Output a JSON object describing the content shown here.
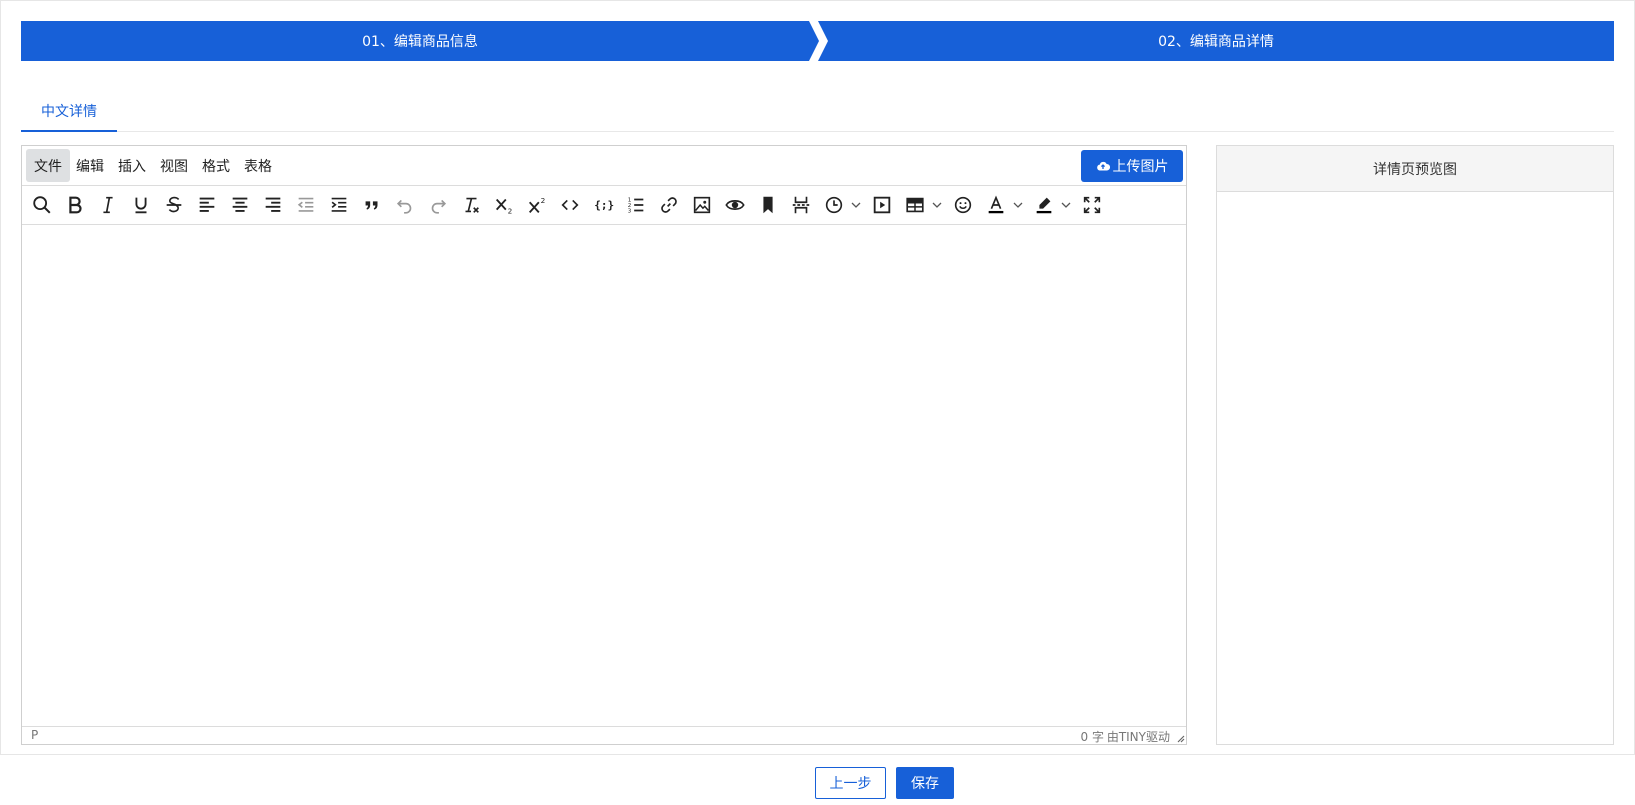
{
  "steps": [
    {
      "label": "01、编辑商品信息"
    },
    {
      "label": "02、编辑商品详情"
    }
  ],
  "tabs": [
    {
      "label": "中文详情"
    }
  ],
  "editor": {
    "menu": [
      "文件",
      "编辑",
      "插入",
      "视图",
      "格式",
      "表格"
    ],
    "active_menu": "文件",
    "upload_label": "上传图片",
    "toolbar_icons": [
      "search-icon",
      "bold-icon",
      "italic-icon",
      "underline-icon",
      "strikethrough-icon",
      "align-left-icon",
      "align-center-icon",
      "align-right-icon",
      "outdent-icon",
      "indent-icon",
      "blockquote-icon",
      "undo-icon",
      "redo-icon",
      "remove-format-icon",
      "subscript-icon",
      "superscript-icon",
      "code-icon",
      "codesample-icon",
      "numbered-list-icon",
      "link-icon",
      "image-icon",
      "preview-icon",
      "bookmark-icon",
      "page-break-icon",
      "time-icon",
      "media-icon",
      "table-icon",
      "emoji-icon",
      "text-color-icon",
      "highlight-icon",
      "fullscreen-icon"
    ],
    "status_path": "P",
    "word_count": "0 字",
    "powered_by": "由TINY驱动"
  },
  "preview": {
    "title": "详情页预览图"
  },
  "footer": {
    "prev_label": "上一步",
    "save_label": "保存"
  },
  "colors": {
    "primary": "#1760d8"
  }
}
